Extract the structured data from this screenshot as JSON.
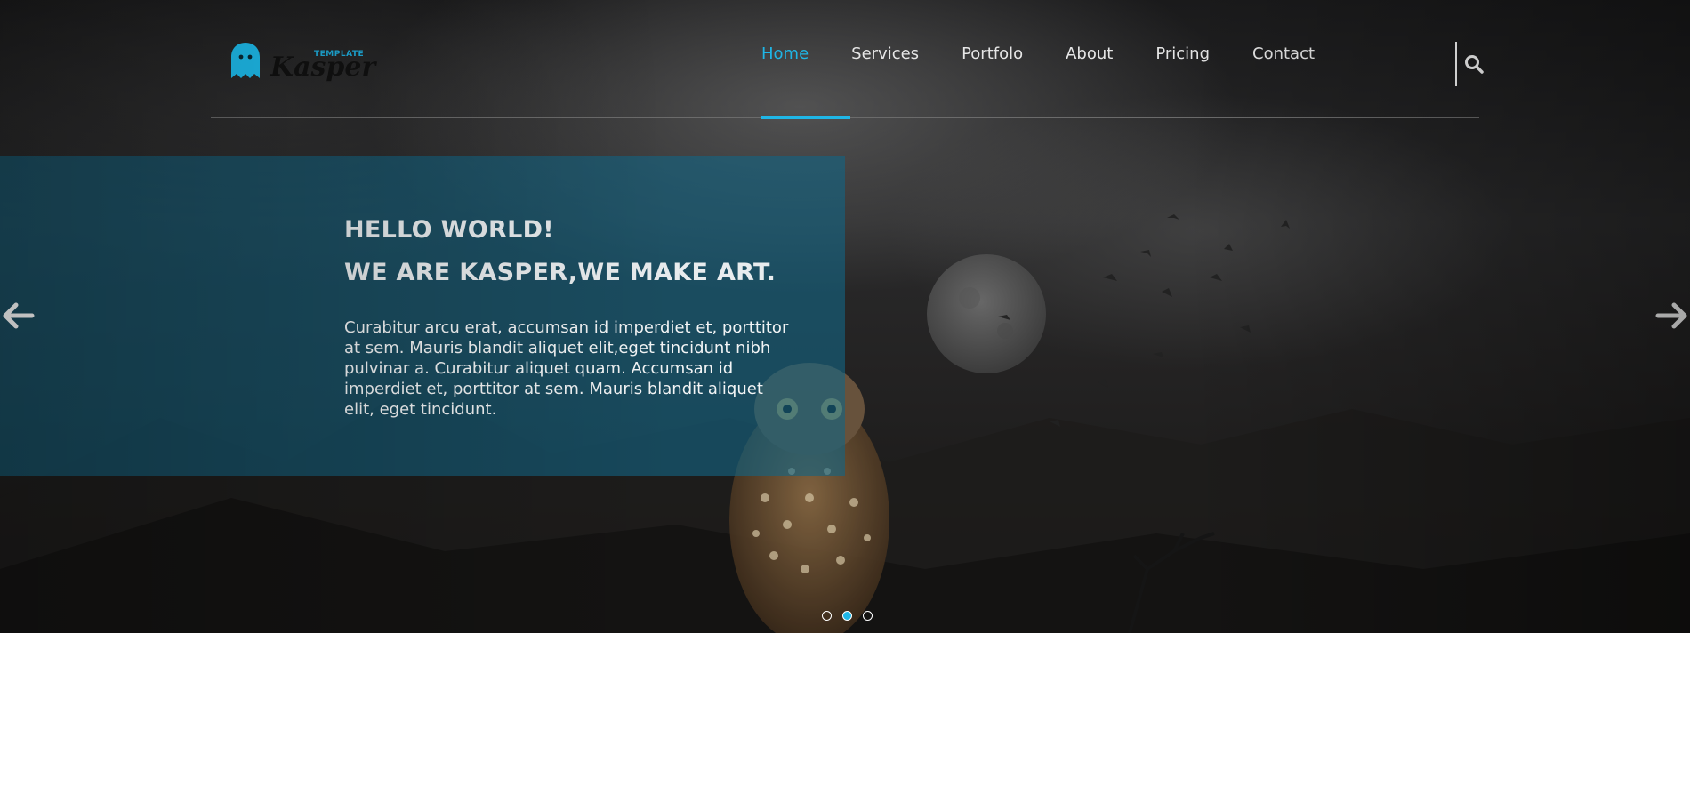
{
  "header": {
    "logo": {
      "small_text": "TEMPLATE",
      "word": "Kasper"
    },
    "nav": [
      {
        "label": "Home",
        "active": true
      },
      {
        "label": "Services",
        "active": false
      },
      {
        "label": "Portfolo",
        "active": false
      },
      {
        "label": "About",
        "active": false
      },
      {
        "label": "Pricing",
        "active": false
      },
      {
        "label": "Contact",
        "active": false
      }
    ],
    "search_icon": "search-icon"
  },
  "slider": {
    "heading_line1": "HELLO WORLD!",
    "heading_line2": "WE ARE KASPER,WE MAKE ART.",
    "paragraph": "Curabitur arcu erat, accumsan id imperdiet et, porttitor at sem. Mauris blandit aliquet elit,eget tincidunt nibh pulvinar a. Curabitur aliquet quam. Accumsan id imperdiet et, porttitor at sem. Mauris blandit aliquet elit, eget tincidunt.",
    "prev_icon": "arrow-left-icon",
    "next_icon": "arrow-right-icon",
    "slide_count": 3,
    "active_slide": 2
  },
  "colors": {
    "accent": "#1fb6e6",
    "overlay": "#14648299",
    "nav_text": "#e6e6e6",
    "background": "#ffffff"
  }
}
